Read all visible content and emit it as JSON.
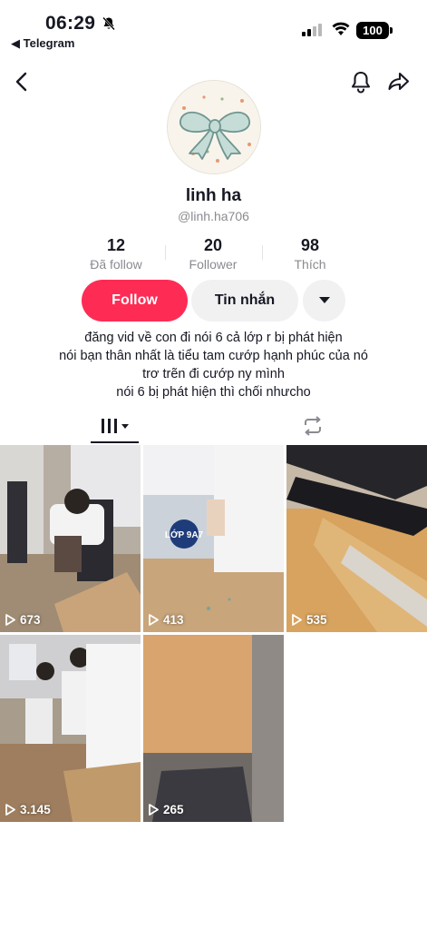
{
  "status_bar": {
    "time": "06:29",
    "back_app": "◀ Telegram",
    "battery": "100"
  },
  "profile": {
    "name": "linh ha",
    "handle": "@linh.ha706"
  },
  "stats": [
    {
      "value": "12",
      "label": "Đã follow"
    },
    {
      "value": "20",
      "label": "Follower"
    },
    {
      "value": "98",
      "label": "Thích"
    }
  ],
  "actions": {
    "follow_label": "Follow",
    "message_label": "Tin nhắn"
  },
  "bio": {
    "lines": [
      "đăng vid về con đi nói 6 cả lớp r bị phát hiện",
      "nói bạn thân nhất là tiểu tam cướp hạnh phúc của nó",
      "trơ trẽn đi cướp ny mình",
      "nói 6 bị phát hiện thì chối nhưcho"
    ]
  },
  "tabs": [
    {
      "icon": "videos-grid-icon",
      "active": true
    },
    {
      "icon": "repost-icon",
      "active": false
    }
  ],
  "videos": [
    {
      "views": "673",
      "sign_text": ""
    },
    {
      "views": "413",
      "sign_text": "LỚP 9A7"
    },
    {
      "views": "535",
      "sign_text": ""
    },
    {
      "views": "3.145",
      "sign_text": ""
    },
    {
      "views": "265",
      "sign_text": ""
    }
  ],
  "colors": {
    "accent": "#fe2c55",
    "secondary_button": "#f1f1f2",
    "muted_text": "#8a8b91"
  }
}
